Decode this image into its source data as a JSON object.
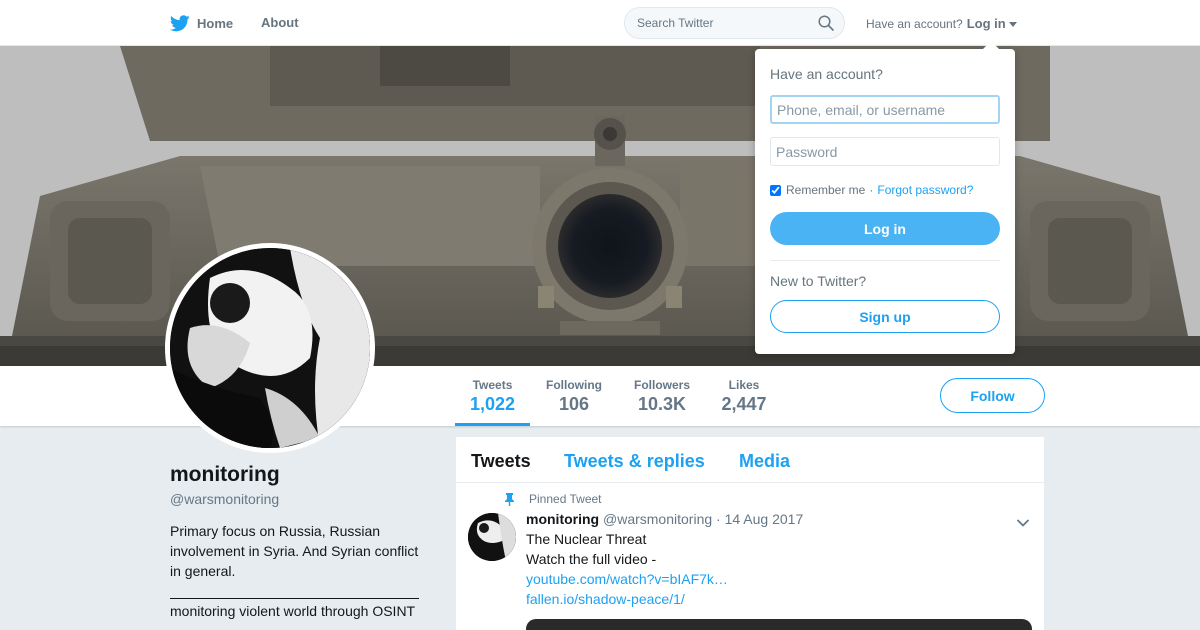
{
  "topnav": {
    "home_label": "Home",
    "about_label": "About",
    "search_placeholder": "Search Twitter",
    "account_prompt": "Have an account?",
    "login_label": "Log in"
  },
  "profile": {
    "name": "monitoring",
    "handle": "@warsmonitoring",
    "bio": "Primary focus on Russia, Russian involvement in Syria. And Syrian conflict in general.",
    "bio_extra": "monitoring violent world through OSINT",
    "follow_label": "Follow"
  },
  "stats": [
    {
      "label": "Tweets",
      "value": "1,022",
      "active": true
    },
    {
      "label": "Following",
      "value": "106",
      "active": false
    },
    {
      "label": "Followers",
      "value": "10.3K",
      "active": false
    },
    {
      "label": "Likes",
      "value": "2,447",
      "active": false
    }
  ],
  "timeline": {
    "tabs": [
      "Tweets",
      "Tweets & replies",
      "Media"
    ],
    "pinned_label": "Pinned Tweet",
    "tweet": {
      "name": "monitoring",
      "handle": "@warsmonitoring",
      "separator": "·",
      "date": "14 Aug 2017",
      "line1": "The Nuclear Threat",
      "line2": "Watch the full video  -",
      "link1": "youtube.com/watch?v=bIAF7k…",
      "link2": "fallen.io/shadow-peace/1/"
    }
  },
  "login_dropdown": {
    "title": "Have an account?",
    "username_placeholder": "Phone, email, or username",
    "password_placeholder": "Password",
    "remember_label": "Remember me",
    "separator": "·",
    "forgot_label": "Forgot password?",
    "login_button": "Log in",
    "new_prompt": "New to Twitter?",
    "signup_button": "Sign up"
  },
  "colors": {
    "accent": "#1da1f2",
    "login_button": "#4ab3f4",
    "background": "#e6ecf0"
  }
}
